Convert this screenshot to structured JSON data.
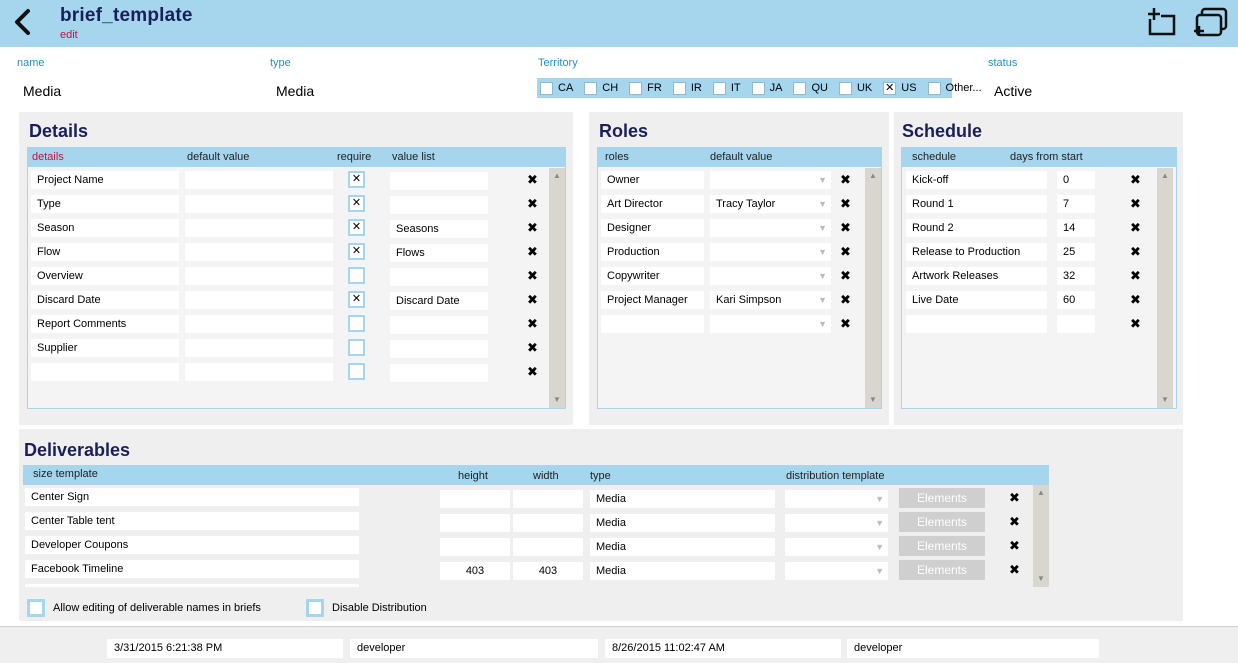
{
  "header": {
    "title": "brief_template",
    "edit_label": "edit"
  },
  "fields": {
    "name": {
      "label": "name",
      "value": "Media"
    },
    "type": {
      "label": "type",
      "value": "Media"
    },
    "territory": {
      "label": "Territory",
      "options": [
        {
          "label": "CA",
          "checked": false
        },
        {
          "label": "CH",
          "checked": false
        },
        {
          "label": "FR",
          "checked": false
        },
        {
          "label": "IR",
          "checked": false
        },
        {
          "label": "IT",
          "checked": false
        },
        {
          "label": "JA",
          "checked": false
        },
        {
          "label": "QU",
          "checked": false
        },
        {
          "label": "UK",
          "checked": false
        },
        {
          "label": "US",
          "checked": true
        },
        {
          "label": "Other...",
          "checked": false
        }
      ]
    },
    "status": {
      "label": "status",
      "value": "Active"
    }
  },
  "details": {
    "title": "Details",
    "headers": {
      "details": "details",
      "default_value": "default value",
      "require": "require",
      "value_list": "value list"
    },
    "rows": [
      {
        "name": "Project Name",
        "default": "",
        "require": true,
        "value_list": ""
      },
      {
        "name": "Type",
        "default": "",
        "require": true,
        "value_list": ""
      },
      {
        "name": "Season",
        "default": "",
        "require": true,
        "value_list": "Seasons"
      },
      {
        "name": "Flow",
        "default": "",
        "require": true,
        "value_list": "Flows"
      },
      {
        "name": "Overview",
        "default": "",
        "require": false,
        "value_list": ""
      },
      {
        "name": "Discard Date",
        "default": "",
        "require": true,
        "value_list": "Discard Date"
      },
      {
        "name": "Report Comments",
        "default": "",
        "require": false,
        "value_list": ""
      },
      {
        "name": "Supplier",
        "default": "",
        "require": false,
        "value_list": ""
      },
      {
        "name": "",
        "default": "",
        "require": false,
        "value_list": ""
      }
    ]
  },
  "roles": {
    "title": "Roles",
    "headers": {
      "roles": "roles",
      "default_value": "default value"
    },
    "rows": [
      {
        "role": "Owner",
        "default": ""
      },
      {
        "role": "Art Director",
        "default": "Tracy Taylor"
      },
      {
        "role": "Designer",
        "default": ""
      },
      {
        "role": "Production",
        "default": ""
      },
      {
        "role": "Copywriter",
        "default": ""
      },
      {
        "role": "Project Manager",
        "default": "Kari Simpson"
      },
      {
        "role": "",
        "default": ""
      }
    ]
  },
  "schedule": {
    "title": "Schedule",
    "headers": {
      "schedule": "schedule",
      "days": "days from start"
    },
    "rows": [
      {
        "name": "Kick-off",
        "days": "0"
      },
      {
        "name": "Round 1",
        "days": "7"
      },
      {
        "name": "Round 2",
        "days": "14"
      },
      {
        "name": "Release to Production",
        "days": "25"
      },
      {
        "name": "Artwork Releases",
        "days": "32"
      },
      {
        "name": "Live Date",
        "days": "60"
      },
      {
        "name": "",
        "days": ""
      }
    ]
  },
  "deliverables": {
    "title": "Deliverables",
    "headers": {
      "size_template": "size template",
      "height": "height",
      "width": "width",
      "type": "type",
      "distribution": "distribution template"
    },
    "rows": [
      {
        "name": "Center Sign",
        "height": "",
        "width": "",
        "type": "Media",
        "distribution": "",
        "button": "Elements"
      },
      {
        "name": "Center Table tent",
        "height": "",
        "width": "",
        "type": "Media",
        "distribution": "",
        "button": "Elements"
      },
      {
        "name": "Developer Coupons",
        "height": "",
        "width": "",
        "type": "Media",
        "distribution": "",
        "button": "Elements"
      },
      {
        "name": "Facebook Timeline",
        "height": "403",
        "width": "403",
        "type": "Media",
        "distribution": "",
        "button": "Elements"
      }
    ],
    "options": {
      "allow_editing": "Allow editing of deliverable names in briefs",
      "disable_distribution": "Disable Distribution"
    }
  },
  "footer": {
    "created": "3/31/2015 6:21:38 PM",
    "created_by": "developer",
    "modified": "8/26/2015 11:02:47 AM",
    "modified_by": "developer"
  },
  "icons": {
    "back": "chevron-left-icon",
    "add": "new-record-icon",
    "duplicate": "duplicate-record-icon",
    "delete": "delete-x-icon",
    "check": "checkbox-x-icon"
  },
  "colors": {
    "header_bg": "#a5d6ee",
    "title": "#1a1f5a",
    "accent_red": "#c0143c",
    "label_blue": "#2a8ec0",
    "panel_bg": "#efefef"
  }
}
